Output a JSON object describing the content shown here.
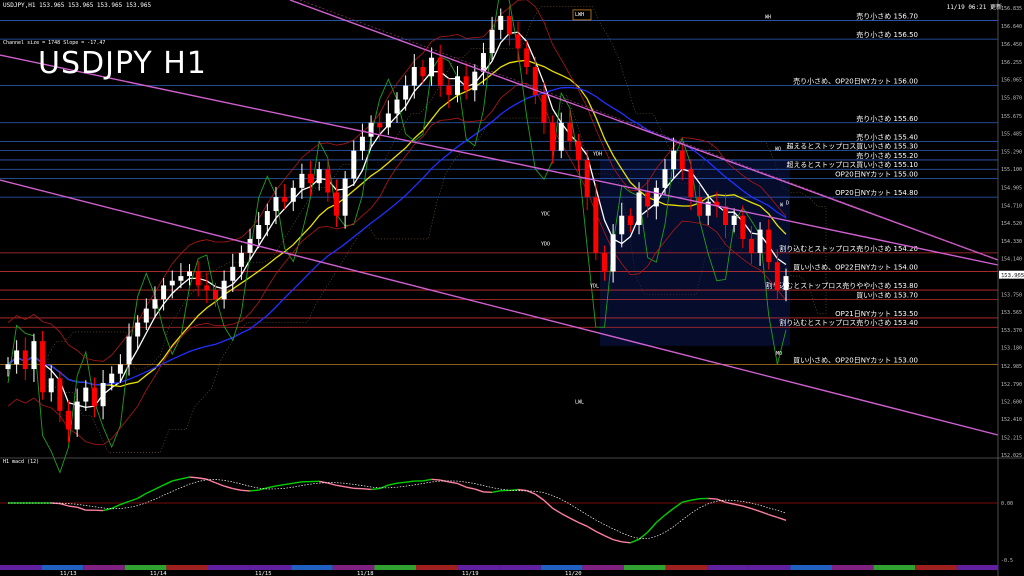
{
  "header": {
    "symbol_line": "USDJPY,H1  153.965 153.965 153.965 153.965",
    "channel_info": "Channel size = 1748 Slope = -17.47",
    "timestamp": "11/19 06:21 更新",
    "big_title": "USDJPY H1",
    "indicator_label": "H1  macd (12)"
  },
  "colors": {
    "background": "#000000",
    "bull_candle": "#ffffff",
    "bear_candle": "#ff0000",
    "sma_fast": "#ffffff",
    "sma_mid": "#e8e000",
    "sma_slow": "#2030ff",
    "channel": "#d060d0",
    "level_line": "#3060c0",
    "ichimoku": "#ffd24d",
    "macd_up": "#00d000",
    "macd_down": "#ff80a0",
    "macd_signal": "#ffffff"
  },
  "chart_data": {
    "type": "candlestick",
    "ylim": [
      152.025,
      156.835
    ],
    "price_ticks": [
      "156.835",
      "156.640",
      "156.450",
      "156.255",
      "156.065",
      "155.870",
      "155.675",
      "155.485",
      "155.290",
      "155.100",
      "154.905",
      "154.710",
      "154.520",
      "154.330",
      "154.140",
      "153.945",
      "153.750",
      "153.565",
      "153.370",
      "153.180",
      "152.985",
      "152.790",
      "152.600",
      "152.410",
      "152.215",
      "152.025"
    ],
    "current_price": "153.965",
    "x_dates": [
      "11/13",
      "11/14",
      "11/15",
      "11/18",
      "11/19",
      "11/20"
    ],
    "close_path": [
      153.0,
      153.15,
      152.95,
      153.25,
      152.7,
      152.85,
      152.5,
      152.3,
      152.6,
      152.75,
      152.55,
      152.8,
      152.9,
      153.0,
      153.3,
      153.45,
      153.6,
      153.7,
      153.85,
      153.9,
      153.95,
      154.0,
      153.85,
      153.8,
      153.7,
      153.9,
      154.05,
      154.2,
      154.35,
      154.5,
      154.65,
      154.8,
      154.75,
      154.9,
      155.05,
      154.95,
      155.1,
      154.85,
      154.6,
      155.0,
      155.3,
      155.45,
      155.6,
      155.55,
      155.7,
      155.85,
      156.0,
      156.2,
      156.1,
      156.3,
      156.0,
      155.9,
      156.1,
      155.95,
      156.15,
      156.35,
      156.6,
      156.75,
      156.55,
      156.4,
      156.2,
      155.9,
      155.6,
      155.3,
      155.6,
      155.4,
      155.2,
      154.8,
      154.2,
      154.0,
      154.4,
      154.6,
      154.5,
      154.85,
      154.7,
      154.9,
      155.1,
      155.3,
      155.1,
      154.8,
      154.6,
      154.75,
      154.7,
      154.5,
      154.6,
      154.35,
      154.2,
      154.45,
      154.1,
      153.8,
      153.95
    ],
    "levels": [
      {
        "label": "売り小さめ 156.70",
        "price": 156.7,
        "color": "#3060c0"
      },
      {
        "label": "売り小さめ 156.50",
        "price": 156.5,
        "color": "#3060c0"
      },
      {
        "label": "売り小さめ、OP20日NYカット 156.00",
        "price": 156.0,
        "color": "#3060c0"
      },
      {
        "label": "売り小さめ 155.60",
        "price": 155.6,
        "color": "#3060c0"
      },
      {
        "label": "売り小さめ 155.40",
        "price": 155.4,
        "color": "#3060c0"
      },
      {
        "label": "超えるとストップロス買い小さめ 155.30",
        "price": 155.3,
        "color": "#3060c0"
      },
      {
        "label": "売り小さめ 155.20",
        "price": 155.2,
        "color": "#3060c0"
      },
      {
        "label": "超えるとストップロス買い小さめ 155.10",
        "price": 155.1,
        "color": "#3060c0"
      },
      {
        "label": "OP20日NYカット 155.00",
        "price": 155.0,
        "color": "#3060c0"
      },
      {
        "label": "OP20日NYカット 154.80",
        "price": 154.8,
        "color": "#3060c0"
      },
      {
        "label": "割り込むとストップロス売り小さめ 154.20",
        "price": 154.2,
        "color": "#c03030"
      },
      {
        "label": "買い小さめ、OP22日NYカット 154.00",
        "price": 154.0,
        "color": "#c03030"
      },
      {
        "label": "割り込むとストップロス売りやや小さめ 153.80",
        "price": 153.8,
        "color": "#c03030"
      },
      {
        "label": "買い小さめ 153.70",
        "price": 153.7,
        "color": "#c03030"
      },
      {
        "label": "OP21日NYカット 153.50",
        "price": 153.5,
        "color": "#c03030"
      },
      {
        "label": "割り込むとストップロス売り小さめ 153.40",
        "price": 153.4,
        "color": "#c03030"
      },
      {
        "label": "買い小さめ、OP20日NYカット 153.00",
        "price": 153.0,
        "color": "#c08020"
      }
    ],
    "tags": [
      "LWH",
      "YDH",
      "YDC",
      "YDO",
      "YDL",
      "LWL",
      "WO",
      "MO",
      "WH",
      "W",
      "D"
    ],
    "macd_ticks": [
      "0.00",
      "-0.5"
    ]
  }
}
